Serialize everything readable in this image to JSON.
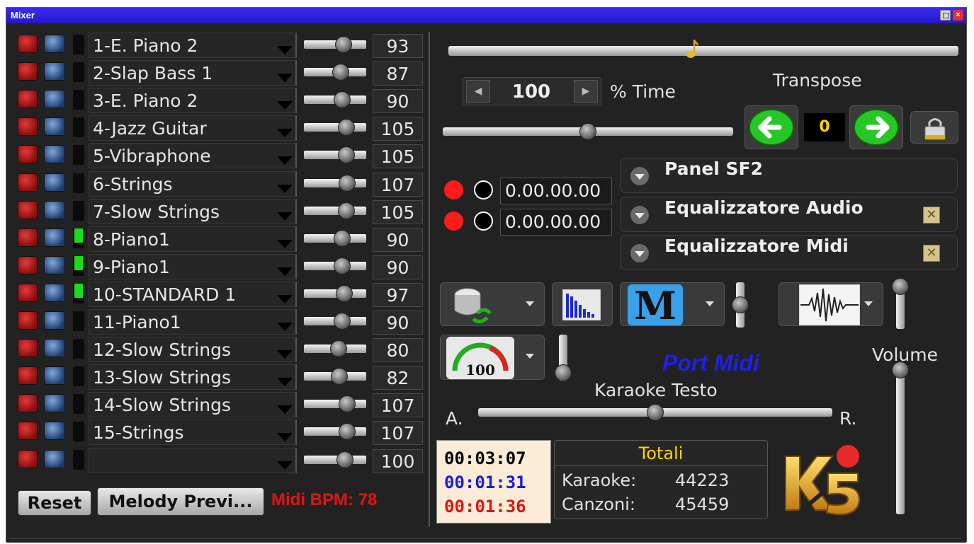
{
  "window": {
    "title": "Mixer"
  },
  "channels": [
    {
      "name": "1-E. Piano 2",
      "volume": "93",
      "level": 0.68,
      "active": false
    },
    {
      "name": "2-Slap Bass 1",
      "volume": "87",
      "level": 0.62,
      "active": false
    },
    {
      "name": "3-E. Piano 2",
      "volume": "90",
      "level": 0.65,
      "active": false
    },
    {
      "name": "4-Jazz Guitar",
      "volume": "105",
      "level": 0.75,
      "active": false
    },
    {
      "name": "5-Vibraphone",
      "volume": "105",
      "level": 0.75,
      "active": false
    },
    {
      "name": "6-Strings",
      "volume": "107",
      "level": 0.76,
      "active": false
    },
    {
      "name": "7-Slow Strings",
      "volume": "105",
      "level": 0.75,
      "active": false
    },
    {
      "name": "8-Piano1",
      "volume": "90",
      "level": 0.65,
      "active": true
    },
    {
      "name": "9-Piano1",
      "volume": "90",
      "level": 0.65,
      "active": true
    },
    {
      "name": "10-STANDARD 1",
      "volume": "97",
      "level": 0.7,
      "active": true
    },
    {
      "name": "11-Piano1",
      "volume": "90",
      "level": 0.65,
      "active": false
    },
    {
      "name": "12-Slow Strings",
      "volume": "80",
      "level": 0.58,
      "active": false
    },
    {
      "name": "13-Slow Strings",
      "volume": "82",
      "level": 0.6,
      "active": false
    },
    {
      "name": "14-Slow Strings",
      "volume": "107",
      "level": 0.76,
      "active": false
    },
    {
      "name": "15-Strings",
      "volume": "107",
      "level": 0.76,
      "active": false
    },
    {
      "name": "",
      "volume": "100",
      "level": 0.72,
      "active": false
    }
  ],
  "buttons": {
    "reset": "Reset",
    "melody_preview": "Melody Previ..."
  },
  "midi_bpm": "Midi BPM: 78",
  "tempo": {
    "value": "100",
    "label": "% Time",
    "level": 0.5
  },
  "position_level": 0.48,
  "transpose": {
    "label": "Transpose",
    "value": "0"
  },
  "recorders": [
    {
      "time": "0.00.00.00"
    },
    {
      "time": "0.00.00.00"
    }
  ],
  "panels": [
    {
      "title": "Panel SF2",
      "checkbox": false
    },
    {
      "title": "Equalizzatore Audio",
      "checkbox": true
    },
    {
      "title": "Equalizzatore Midi",
      "checkbox": true
    }
  ],
  "speedometer_value": "100",
  "port_midi": "Port Midi",
  "karaoke": {
    "label": "Karaoke Testo",
    "left": "A.",
    "right": "R.",
    "level": 0.5
  },
  "volume": {
    "label": "Volume",
    "level": 1.0
  },
  "times": {
    "total": "00:03:07",
    "elapsed": "00:01:31",
    "remaining": "00:01:36"
  },
  "totals": {
    "title": "Totali",
    "karaoke_label": "Karaoke:",
    "karaoke_value": "44223",
    "songs_label": "Canzoni:",
    "songs_value": "45459"
  },
  "colors": {
    "title_bar": "#2218d0",
    "bpm": "#e01414",
    "port_midi": "#1e22e8",
    "totals_title": "#ffd400",
    "time_total": "#000000",
    "time_elapsed": "#1a1ae0",
    "time_remaining": "#e01414"
  },
  "icons": [
    "mute-icon",
    "solo-icon",
    "music-note-icon",
    "arrow-left-icon",
    "arrow-right-icon",
    "lock-icon",
    "database-sync-icon",
    "bars-chart-icon",
    "m-logo-icon",
    "waveform-icon",
    "speedometer-icon",
    "k5-logo"
  ]
}
